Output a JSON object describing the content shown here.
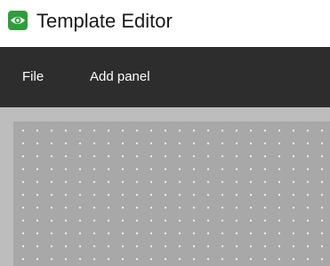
{
  "window": {
    "title": "Template Editor",
    "icon": "eye-icon",
    "icon_color": "#2e9e3a"
  },
  "menubar": {
    "items": [
      {
        "label": "File"
      },
      {
        "label": "Add panel"
      }
    ],
    "background": "#2d2d2d"
  },
  "workspace": {
    "background": "#bdbdbd",
    "canvas_background": "#a8a8a8",
    "grid": "dotted"
  }
}
